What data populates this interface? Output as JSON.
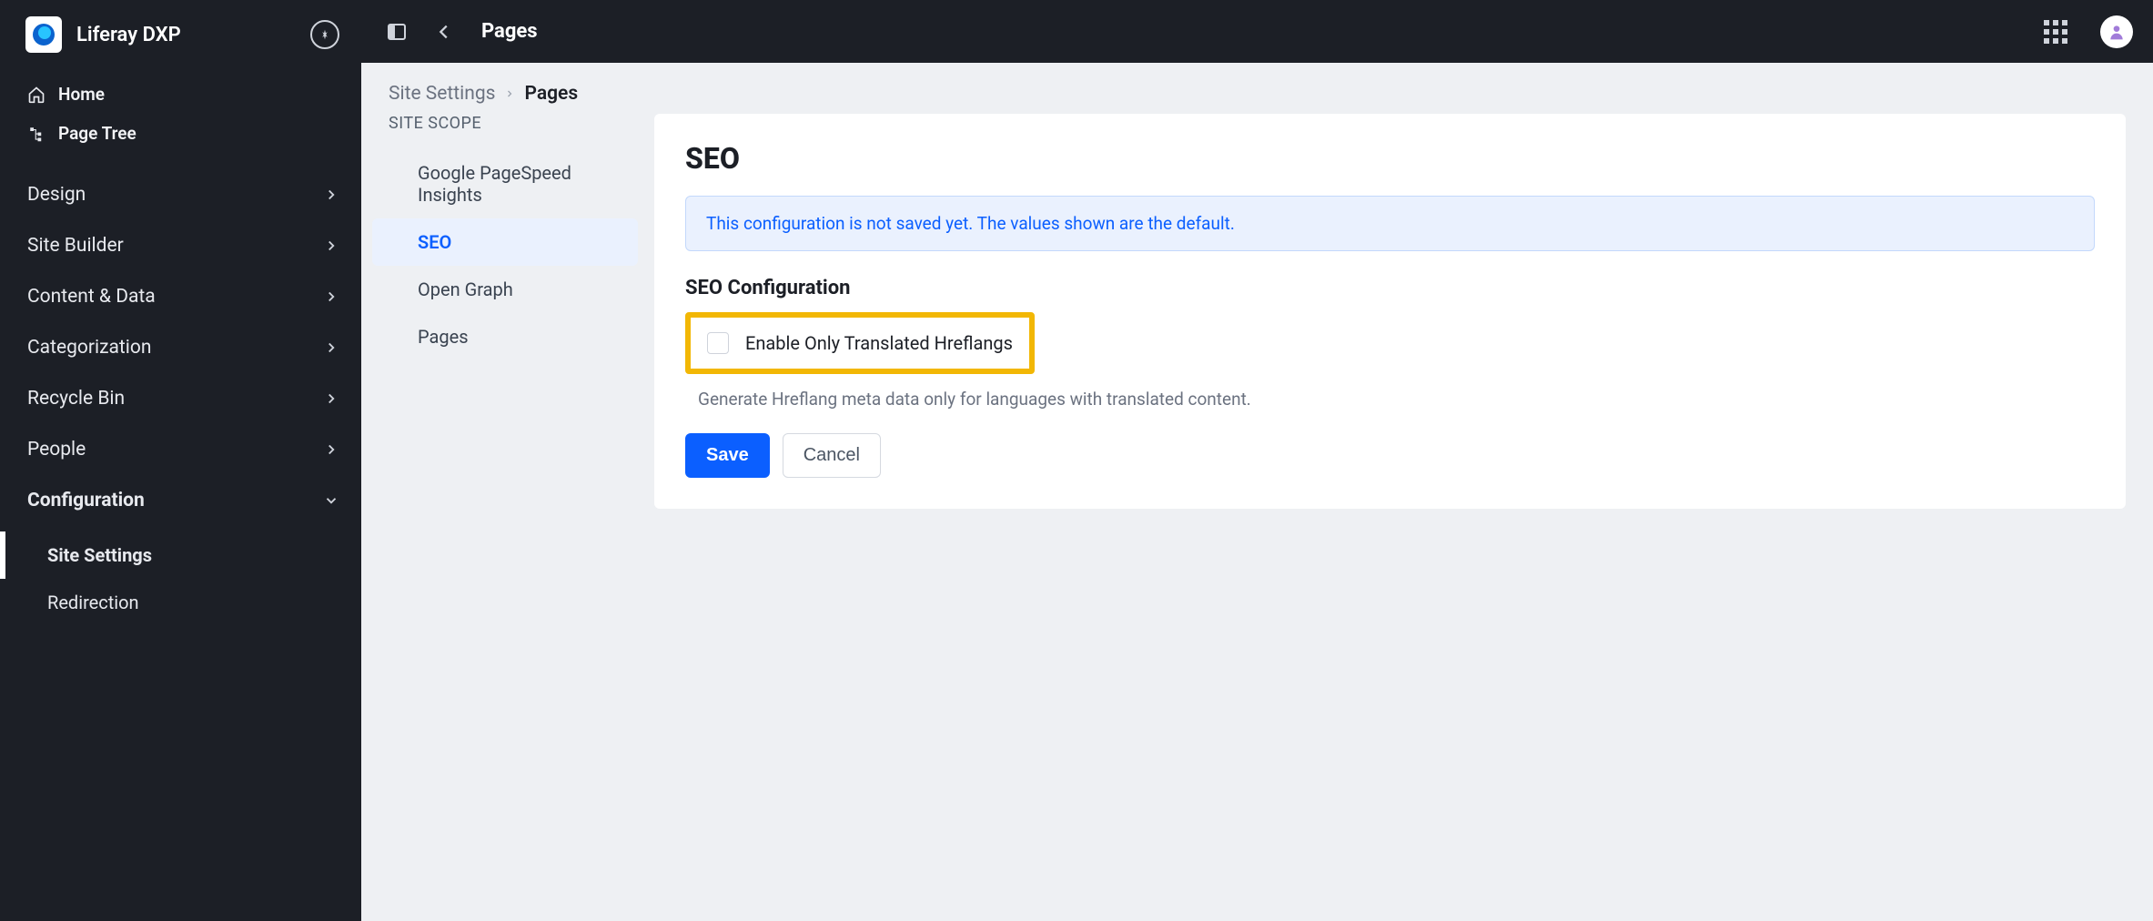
{
  "app": {
    "title": "Liferay DXP"
  },
  "sidebar": {
    "top_links": [
      {
        "label": "Home"
      },
      {
        "label": "Page Tree"
      }
    ],
    "sections": [
      {
        "label": "Design",
        "expanded": false
      },
      {
        "label": "Site Builder",
        "expanded": false
      },
      {
        "label": "Content & Data",
        "expanded": false
      },
      {
        "label": "Categorization",
        "expanded": false
      },
      {
        "label": "Recycle Bin",
        "expanded": false
      },
      {
        "label": "People",
        "expanded": false
      },
      {
        "label": "Configuration",
        "expanded": true
      }
    ],
    "config_children": [
      {
        "label": "Site Settings",
        "active": true
      },
      {
        "label": "Redirection",
        "active": false
      }
    ]
  },
  "topbar": {
    "title": "Pages"
  },
  "breadcrumb": {
    "parent": "Site Settings",
    "current": "Pages"
  },
  "scope": {
    "heading": "SITE SCOPE",
    "items": [
      {
        "label": "Google PageSpeed Insights",
        "active": false
      },
      {
        "label": "SEO",
        "active": true
      },
      {
        "label": "Open Graph",
        "active": false
      },
      {
        "label": "Pages",
        "active": false
      }
    ]
  },
  "panel": {
    "title": "SEO",
    "info": "This configuration is not saved yet. The values shown are the default.",
    "section_title": "SEO Configuration",
    "checkbox_label": "Enable Only Translated Hreflangs",
    "checkbox_checked": false,
    "help_text": "Generate Hreflang meta data only for languages with translated content.",
    "save_label": "Save",
    "cancel_label": "Cancel"
  },
  "colors": {
    "accent": "#0b5fff",
    "sidebar_bg": "#1c1f26",
    "highlight": "#f2b705"
  }
}
